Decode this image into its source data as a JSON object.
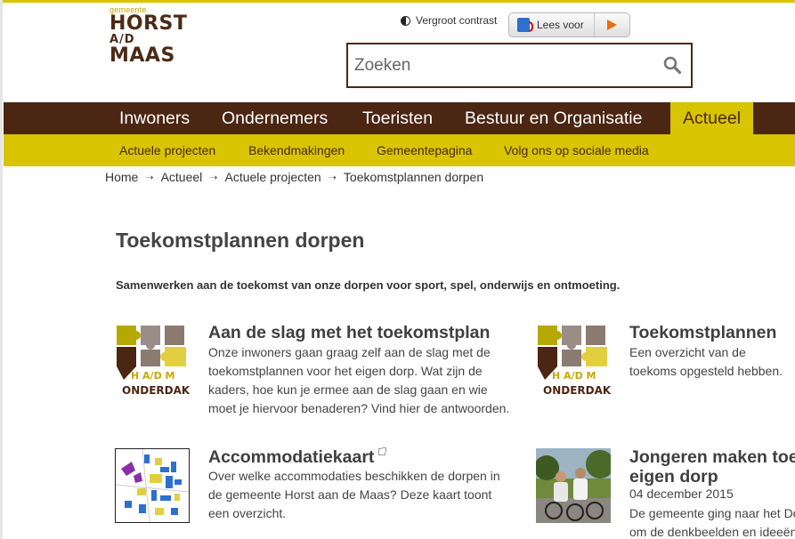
{
  "header": {
    "logo": {
      "small": "gemeente",
      "line1": "HORST",
      "line2": "A/D",
      "line3": "MAAS"
    },
    "contrast_label": "Vergroot contrast",
    "leesvoor_label": "Lees voor",
    "search": {
      "placeholder": "Zoeken"
    }
  },
  "main_nav": [
    "Inwoners",
    "Ondernemers",
    "Toeristen",
    "Bestuur en Organisatie",
    "Actueel"
  ],
  "sub_nav": [
    "Actuele projecten",
    "Bekendmakingen",
    "Gemeentepagina",
    "Volg ons op sociale media"
  ],
  "breadcrumb": [
    "Home",
    "Actueel",
    "Actuele projecten",
    "Toekomstplannen dorpen"
  ],
  "page": {
    "title": "Toekomstplannen dorpen",
    "intro": "Samenwerken aan de toekomst van onze dorpen voor sport, spel, onderwijs en ontmoeting."
  },
  "cards": [
    {
      "title": "Aan de slag met het toekomstplan",
      "text": "Onze inwoners gaan graag zelf aan de slag met de toekomstplannen voor het eigen dorp. Wat zijn de kaders, hoe kun je ermee aan de slag gaan en wie moet je hiervoor benaderen? Vind hier de antwoorden.",
      "thumb_text": [
        "H A/D M",
        "ONDERDAK"
      ]
    },
    {
      "title": "Toekomstplannen",
      "text": "Een overzicht van de toekoms opgesteld hebben.",
      "thumb_text": [
        "H A/D M",
        "ONDERDAK"
      ]
    },
    {
      "title": "Accommodatiekaart",
      "text": "Over welke accommodaties beschikken de dorpen in de gemeente Horst aan de Maas? Deze kaart toont een overzicht."
    },
    {
      "title_line1": "Jongeren maken toe",
      "title_line2": "eigen dorp",
      "date": "04 december 2015",
      "text_line1": "De gemeente ging naar het De",
      "text_line2": "om de denkbeelden en ideeën"
    }
  ],
  "colors": {
    "brown": "#4b2613",
    "yellow": "#d8c400"
  }
}
